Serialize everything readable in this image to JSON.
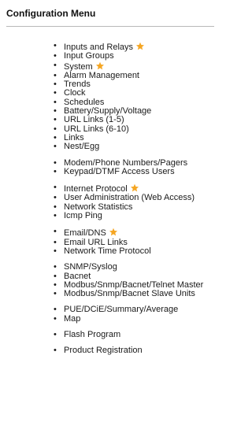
{
  "title": "Configuration Menu",
  "star_color": "#f5a623",
  "groups": [
    [
      {
        "label": "Inputs and Relays",
        "starred": true
      },
      {
        "label": "Input Groups",
        "starred": false
      },
      {
        "label": "System",
        "starred": true
      },
      {
        "label": "Alarm Management",
        "starred": false
      },
      {
        "label": "Trends",
        "starred": false
      },
      {
        "label": "Clock",
        "starred": false
      },
      {
        "label": "Schedules",
        "starred": false
      },
      {
        "label": "Battery/Supply/Voltage",
        "starred": false
      },
      {
        "label": "URL Links (1-5)",
        "starred": false
      },
      {
        "label": "URL Links (6-10)",
        "starred": false
      },
      {
        "label": "Links",
        "starred": false
      },
      {
        "label": "Nest/Egg",
        "starred": false
      }
    ],
    [
      {
        "label": "Modem/Phone Numbers/Pagers",
        "starred": false
      },
      {
        "label": "Keypad/DTMF Access Users",
        "starred": false
      }
    ],
    [
      {
        "label": "Internet Protocol",
        "starred": true
      },
      {
        "label": "User Administration (Web Access)",
        "starred": false
      },
      {
        "label": "Network Statistics",
        "starred": false
      },
      {
        "label": "Icmp Ping",
        "starred": false
      }
    ],
    [
      {
        "label": "Email/DNS",
        "starred": true
      },
      {
        "label": "Email URL Links",
        "starred": false
      },
      {
        "label": "Network Time Protocol",
        "starred": false
      }
    ],
    [
      {
        "label": "SNMP/Syslog",
        "starred": false
      },
      {
        "label": "Bacnet",
        "starred": false
      },
      {
        "label": "Modbus/Snmp/Bacnet/Telnet Master",
        "starred": false
      },
      {
        "label": "Modbus/Snmp/Bacnet Slave Units",
        "starred": false
      }
    ],
    [
      {
        "label": "PUE/DCiE/Summary/Average",
        "starred": false
      },
      {
        "label": "Map",
        "starred": false
      }
    ],
    [
      {
        "label": "Flash Program",
        "starred": false
      }
    ],
    [
      {
        "label": "Product Registration",
        "starred": false
      }
    ]
  ]
}
